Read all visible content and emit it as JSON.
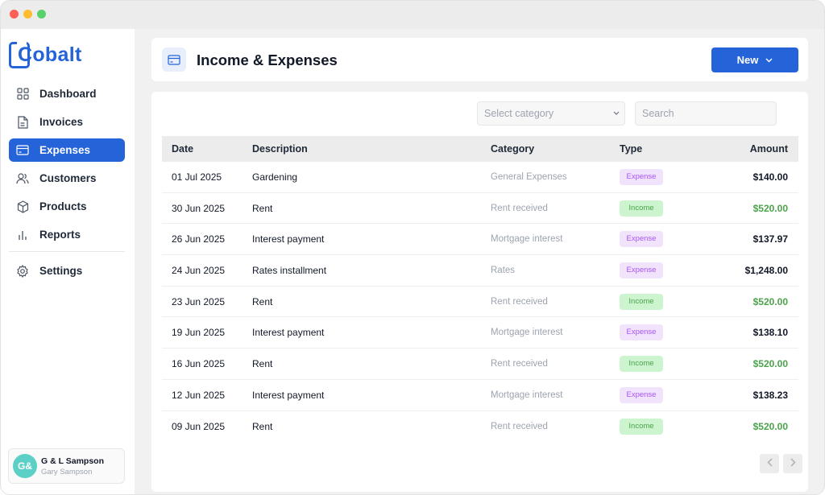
{
  "window": {
    "controls": [
      "close",
      "minimize",
      "maximize"
    ]
  },
  "brand": {
    "name": "Cobalt",
    "color": "#2563d8"
  },
  "sidebar": {
    "items": [
      {
        "label": "Dashboard",
        "icon": "grid-icon"
      },
      {
        "label": "Invoices",
        "icon": "document-icon"
      },
      {
        "label": "Expenses",
        "icon": "card-icon",
        "active": true
      },
      {
        "label": "Customers",
        "icon": "users-icon"
      },
      {
        "label": "Products",
        "icon": "box-icon"
      },
      {
        "label": "Reports",
        "icon": "bar-chart-icon"
      }
    ],
    "settings": {
      "label": "Settings",
      "icon": "gear-icon"
    },
    "user": {
      "initials": "G&",
      "name": "G & L Sampson",
      "subtitle": "Gary Sampson"
    }
  },
  "header": {
    "title": "Income & Expenses",
    "icon": "card-icon",
    "new_label": "New"
  },
  "filters": {
    "category_placeholder": "Select category",
    "search_placeholder": "Search"
  },
  "table": {
    "columns": [
      "Date",
      "Description",
      "Category",
      "Type",
      "Amount"
    ],
    "rows": [
      {
        "date": "01 Jul 2025",
        "description": "Gardening",
        "category": "General Expenses",
        "type": "Expense",
        "amount": "$140.00"
      },
      {
        "date": "30 Jun 2025",
        "description": "Rent",
        "category": "Rent received",
        "type": "Income",
        "amount": "$520.00"
      },
      {
        "date": "26 Jun 2025",
        "description": "Interest payment",
        "category": "Mortgage interest",
        "type": "Expense",
        "amount": "$137.97"
      },
      {
        "date": "24 Jun 2025",
        "description": "Rates installment",
        "category": "Rates",
        "type": "Expense",
        "amount": "$1,248.00"
      },
      {
        "date": "23 Jun 2025",
        "description": "Rent",
        "category": "Rent received",
        "type": "Income",
        "amount": "$520.00"
      },
      {
        "date": "19 Jun 2025",
        "description": "Interest payment",
        "category": "Mortgage interest",
        "type": "Expense",
        "amount": "$138.10"
      },
      {
        "date": "16 Jun 2025",
        "description": "Rent",
        "category": "Rent received",
        "type": "Income",
        "amount": "$520.00"
      },
      {
        "date": "12 Jun 2025",
        "description": "Interest payment",
        "category": "Mortgage interest",
        "type": "Expense",
        "amount": "$138.23"
      },
      {
        "date": "09 Jun 2025",
        "description": "Rent",
        "category": "Rent received",
        "type": "Income",
        "amount": "$520.00"
      }
    ]
  },
  "pagination": {
    "prev_icon": "chevron-left-icon",
    "next_icon": "chevron-right-icon"
  },
  "colors": {
    "accent": "#2563d8",
    "income": "#4aa34a",
    "expense": "#a855f7"
  }
}
